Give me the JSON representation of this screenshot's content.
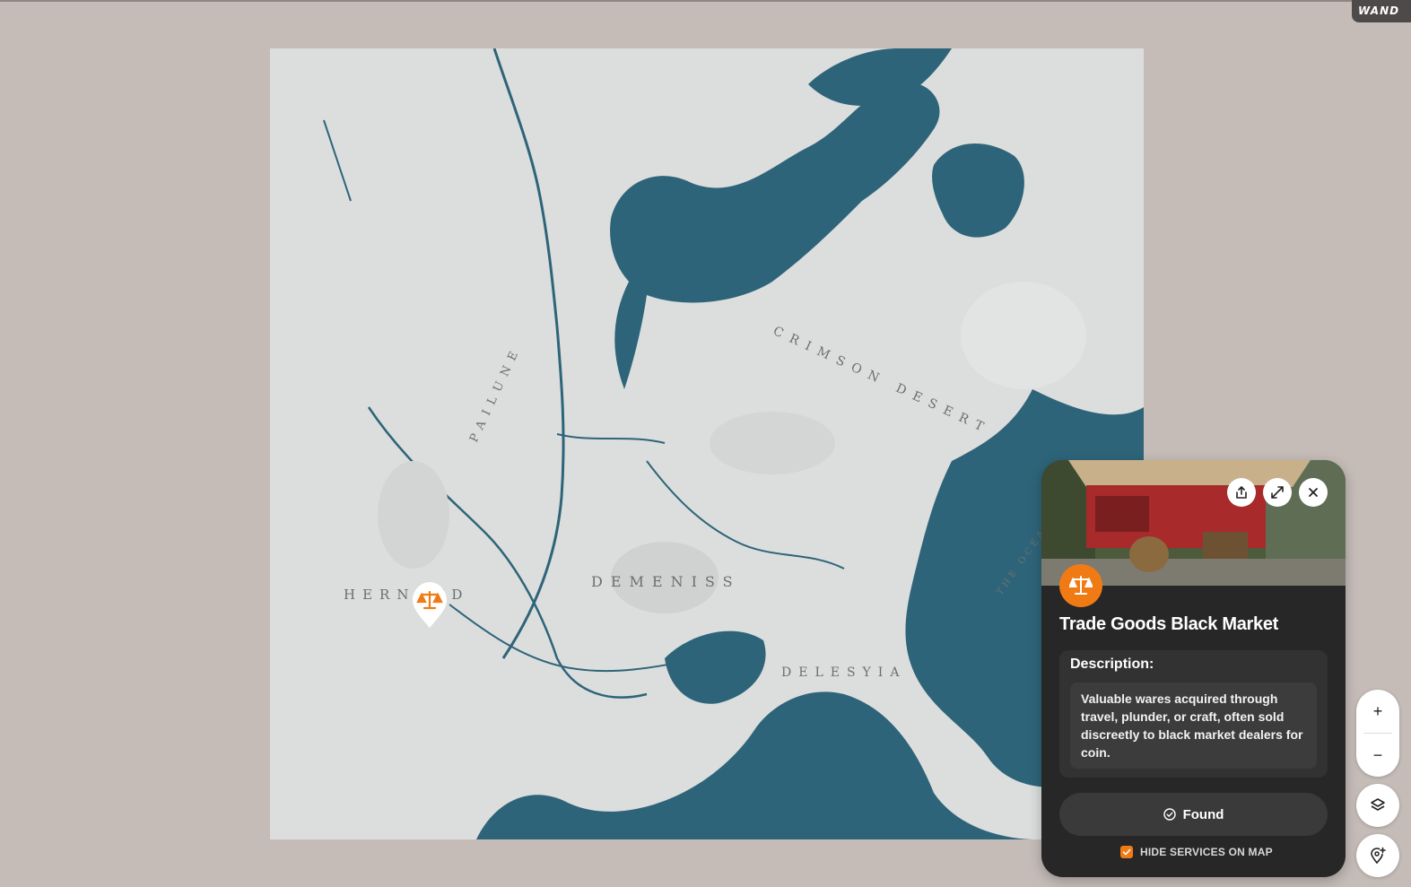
{
  "brand": {
    "logo_text": "WAND"
  },
  "map": {
    "regions": [
      {
        "name": "HERNAND"
      },
      {
        "name": "DEMENISS"
      },
      {
        "name": "CRIMSON DESERT"
      },
      {
        "name": "PAILUNE"
      },
      {
        "name": "DELESYIA"
      },
      {
        "name": "THE OCEAN"
      }
    ],
    "colors": {
      "land": "#dcdedd",
      "water": "#2e6479"
    },
    "marker_icon": "scales-icon"
  },
  "panel": {
    "title": "Trade Goods Black Market",
    "description_label": "Description:",
    "description": "Valuable wares acquired through travel, plunder, or craft, often sold discreetly to black market dealers for coin.",
    "found_label": "Found",
    "hide_label": "HIDE SERVICES ON MAP",
    "hide_checked": true,
    "accent": "#f07b14",
    "icons": [
      "share-icon",
      "expand-icon",
      "close-icon",
      "scales-icon",
      "check-circle-icon"
    ]
  },
  "controls": {
    "zoom_in": "+",
    "zoom_out": "−",
    "icons": [
      "layers-icon",
      "add-marker-icon"
    ]
  }
}
